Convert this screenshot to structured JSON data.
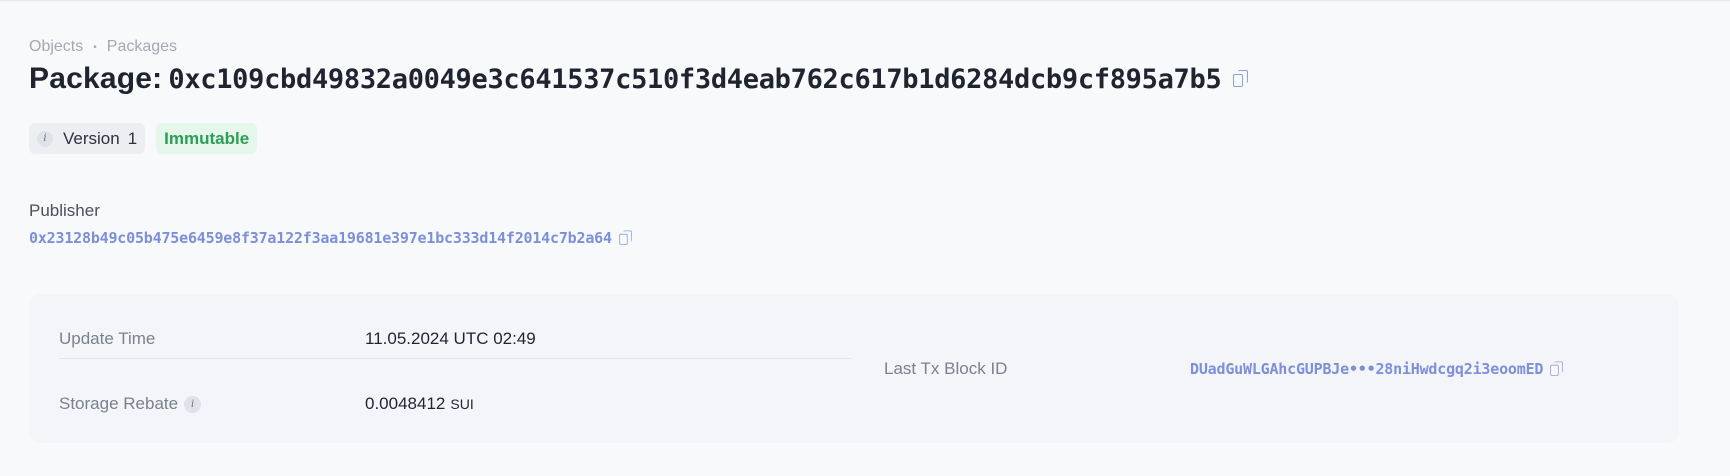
{
  "breadcrumb": {
    "items": [
      "Objects",
      "Packages"
    ],
    "separator": "•"
  },
  "title": {
    "label": "Package:",
    "id": "0xc109cbd49832a0049e3c641537c510f3d4eab762c617b1d6284dcb9cf895a7b5"
  },
  "badges": {
    "version_label": "Version",
    "version_value": "1",
    "status": "Immutable"
  },
  "publisher": {
    "label": "Publisher",
    "address": "0x23128b49c05b475e6459e8f37a122f3aa19681e397e1bc333d14f2014c7b2a64"
  },
  "details": {
    "update_time_label": "Update Time",
    "update_time_value": "11.05.2024 UTC 02:49",
    "storage_rebate_label": "Storage Rebate",
    "storage_rebate_value": "0.0048412",
    "storage_rebate_unit": "SUI",
    "last_tx_label": "Last Tx Block ID",
    "last_tx_value": "DUadGuWLGAhcGUPBJe•••28niHwdcgq2i3eoomED"
  },
  "icons": {
    "info": "info-icon",
    "copy": "copy-icon"
  },
  "colors": {
    "accent_link": "#7c8fd8",
    "immutable_text": "#2f9d58",
    "immutable_bg": "#e4f7ea"
  }
}
